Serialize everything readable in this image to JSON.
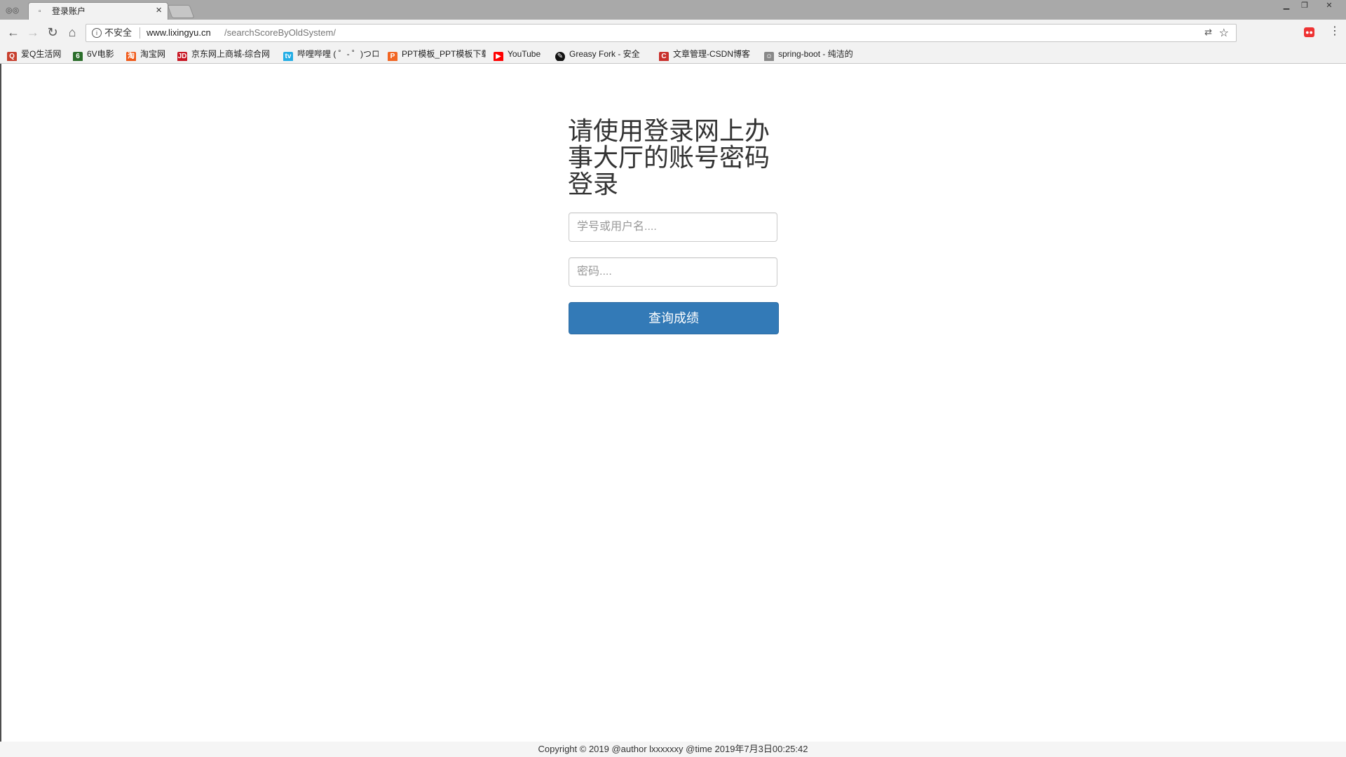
{
  "browser": {
    "tab": {
      "title": "登录账户",
      "favicon": "tab-favicon"
    },
    "address": {
      "security_label": "不安全",
      "url_domain": "www.lixingyu.cn",
      "url_path": "/searchScoreByOldSystem/"
    },
    "bookmarks": [
      {
        "label": "爱Q生活网",
        "icon": "aiq-icon",
        "color": "#c8402e"
      },
      {
        "label": "6V电影",
        "icon": "6v-icon",
        "color": "#2a6d2a"
      },
      {
        "label": "淘宝网",
        "icon": "taobao-icon",
        "color": "#f05a1a"
      },
      {
        "label": "京东网上商城-综合网",
        "icon": "jd-icon",
        "color": "#c81623"
      },
      {
        "label": "哔哩哔哩 ( ゜- ゜)つロ",
        "icon": "bilibili-icon",
        "color": "#23ade5"
      },
      {
        "label": "PPT模板_PPT模板下载",
        "icon": "ppt-icon",
        "color": "#f26522"
      },
      {
        "label": "YouTube",
        "icon": "youtube-icon",
        "color": "#ff0000"
      },
      {
        "label": "Greasy Fork - 安全",
        "icon": "greasyfork-icon",
        "color": "#111111"
      },
      {
        "label": "文章管理-CSDN博客",
        "icon": "csdn-icon",
        "color": "#c9302c"
      },
      {
        "label": "spring-boot - 纯洁的",
        "icon": "springboot-icon",
        "color": "#888888"
      }
    ]
  },
  "login": {
    "heading": "请使用登录网上办事大厅的账号密码登录",
    "username_placeholder": "学号或用户名....",
    "password_placeholder": "密码....",
    "submit_label": "查询成绩"
  },
  "footer": {
    "text": "Copyright © 2019 @author lxxxxxxy @time 2019年7月3日00:25:42"
  },
  "colors": {
    "primary_button": "#337ab7",
    "titlebar": "#a9a9a9",
    "toolbar": "#f2f2f2"
  }
}
